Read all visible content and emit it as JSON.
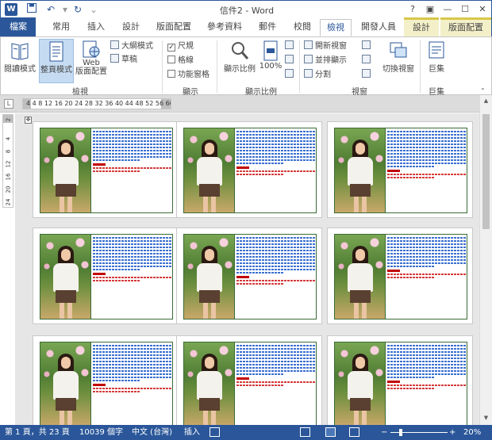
{
  "titlebar": {
    "app_icon": "W",
    "title": "信件2 - Word",
    "qat": {
      "save": "save-icon",
      "undo": "undo-icon",
      "redo": "redo-icon"
    },
    "buttons": {
      "help": "?",
      "ribbon_options": "▣",
      "minimize": "—",
      "maximize": "☐",
      "close": "✕"
    }
  },
  "tabs": [
    {
      "label": "檔案"
    },
    {
      "label": "常用"
    },
    {
      "label": "插入"
    },
    {
      "label": "設計"
    },
    {
      "label": "版面配置"
    },
    {
      "label": "參考資料"
    },
    {
      "label": "郵件"
    },
    {
      "label": "校閱"
    },
    {
      "label": "檢視"
    },
    {
      "label": "開發人員"
    },
    {
      "label": "設計"
    },
    {
      "label": "版面配置"
    }
  ],
  "ribbon": {
    "views": {
      "group_label": "檢視",
      "read_mode": "閱讀模式",
      "print_layout": "整頁模式",
      "web_layout_1": "Web",
      "web_layout_2": "版面配置",
      "outline": "大綱模式",
      "draft": "草稿"
    },
    "show": {
      "group_label": "顯示",
      "ruler": "尺規",
      "ruler_checked": "✓",
      "gridlines": "格線",
      "nav_pane": "功能窗格"
    },
    "zoom": {
      "group_label": "顯示比例",
      "zoom": "顯示比例",
      "hundred": "100%"
    },
    "window": {
      "group_label": "視窗",
      "new_window": "開新視窗",
      "arrange_all": "並排顯示",
      "split": "分割",
      "switch_windows": "切換視窗"
    },
    "macros": {
      "group_label": "巨集",
      "macros": "巨集"
    }
  },
  "ruler": {
    "corner": "L",
    "horizontal": "4  4  8 12 16 20 24 28 32 36 40 44 48 52 56 60 64",
    "vertical": [
      "2",
      "4",
      "8",
      "12",
      "16",
      "20",
      "24"
    ]
  },
  "pages_count": 9,
  "statusbar": {
    "page": "第 1 頁，共 23 頁",
    "words": "10039 個字",
    "language": "中文 (台灣)",
    "mode": "插入",
    "zoom_minus": "−",
    "zoom_plus": "+",
    "zoom": "20%",
    "zoom_level_percent": 20
  }
}
